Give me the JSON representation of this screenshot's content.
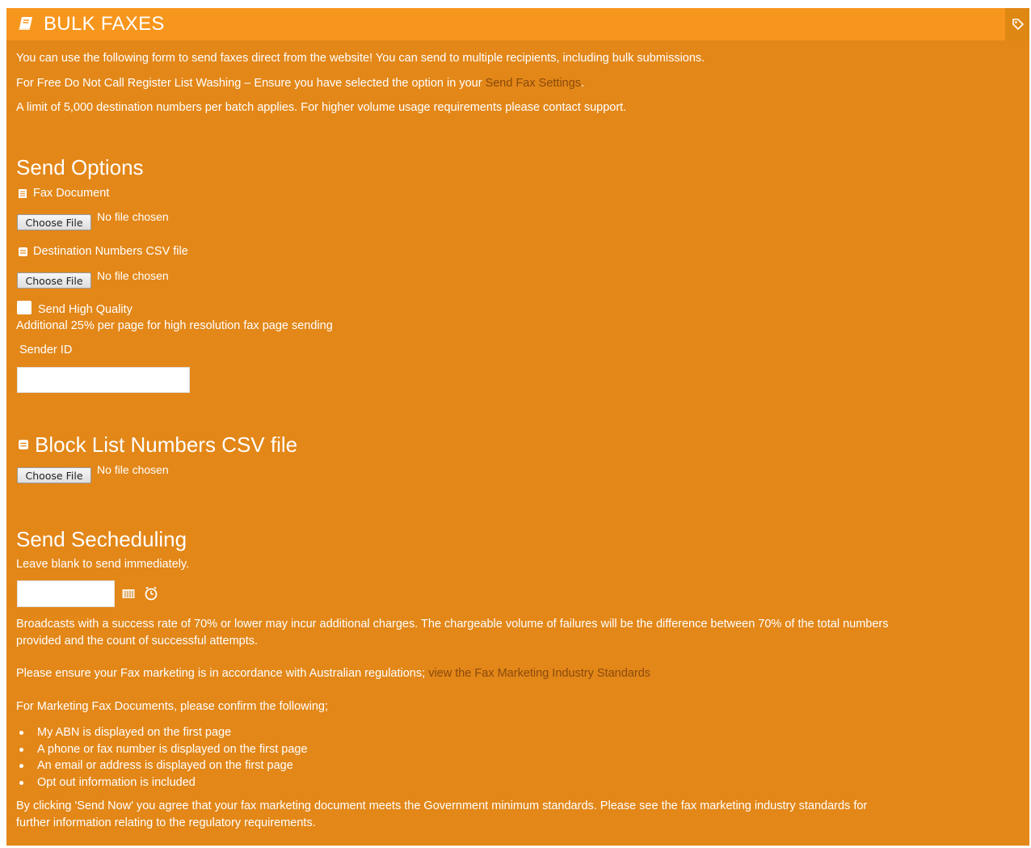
{
  "header": {
    "title": "BULK FAXES",
    "icon": "book-icon",
    "tool_icon": "tag-icon"
  },
  "intro": {
    "line1": "You can use the following form to send faxes direct from the website! You can send to multiple recipients, including bulk submissions.",
    "line2_prefix": "For Free Do Not Call Register List Washing – Ensure you have selected the option in your ",
    "line2_link": "Send Fax Settings",
    "line2_suffix": ".",
    "line3": "A limit of 5,000 destination numbers per batch applies. For higher volume usage requirements please contact support."
  },
  "send_options": {
    "heading": "Send Options",
    "fax_document_label": "Fax Document",
    "destination_label": "Destination Numbers CSV file",
    "choose_file_label": "Choose File",
    "no_file_text": "No file chosen",
    "high_quality_label": "Send High Quality",
    "high_quality_checked": false,
    "high_quality_note": "Additional 25% per page for high resolution fax page sending",
    "sender_id_label": "Sender ID",
    "sender_id_value": ""
  },
  "block_list": {
    "heading": "Block List Numbers CSV file",
    "choose_file_label": "Choose File",
    "no_file_text": "No file chosen"
  },
  "scheduling": {
    "heading": "Send Secheduling",
    "note": "Leave blank to send immediately.",
    "date_value": "",
    "calendar_icon": "calendar-icon",
    "clock_icon": "clock-icon"
  },
  "footer": {
    "broadcast_line1": "Broadcasts with a success rate of 70% or lower may incur additional charges. The chargeable volume of failures will be the difference between 70% of the total numbers",
    "broadcast_line2": "provided and the count of successful attempts.",
    "regulation_prefix": "Please ensure your Fax marketing is in accordance with Australian regulations; ",
    "regulation_link": "view the Fax Marketing Industry Standards",
    "confirm_intro": "For Marketing Fax Documents, please confirm the following;",
    "confirm_items": [
      "My ABN is displayed on the first page",
      "A phone or fax number is displayed on the first page",
      "An email or address is displayed on the first page",
      "Opt out information is included"
    ],
    "agree_line1": "By clicking 'Send Now' you agree that your fax marketing document meets the Government minimum standards. Please see the fax marketing industry standards for",
    "agree_line2": "further information relating to the regulatory requirements."
  },
  "colors": {
    "panel_bg": "#e38718",
    "header_bg": "#f7961d",
    "link": "#8a4a0c",
    "text": "#ffffff"
  }
}
